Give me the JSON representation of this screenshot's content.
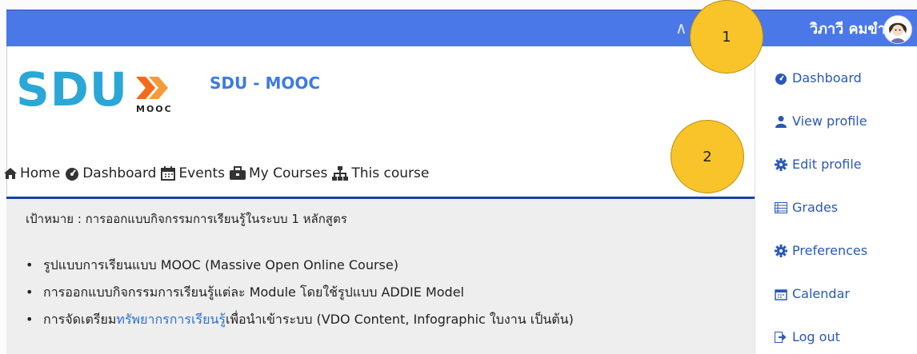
{
  "topbar": {
    "user_name": "วิภาวี คมขำ",
    "caret": "∧"
  },
  "logo": {
    "text": "SDU",
    "sub": "MOOC"
  },
  "site": {
    "name": "SDU - MOOC"
  },
  "nav": [
    {
      "label": "Home",
      "icon": "home-icon"
    },
    {
      "label": "Dashboard",
      "icon": "dashboard-icon"
    },
    {
      "label": "Events",
      "icon": "calendar-icon"
    },
    {
      "label": "My Courses",
      "icon": "briefcase-icon"
    },
    {
      "label": "This course",
      "icon": "sitemap-icon"
    }
  ],
  "content": {
    "goal": "เป้าหมาย : การออกแบบกิจกรรมการเรียนรู้ในระบบ 1 หลักสูตร",
    "bullets": [
      {
        "text": "รูปแบบการเรียนแบบ MOOC (Massive Open Online Course)"
      },
      {
        "text": "การออกแบบกิจกรรมการเรียนรู้แต่ละ Module โดยใช้รูปแบบ ADDIE Model"
      },
      {
        "pre": "การจัดเตรียม",
        "link": "ทรัพยากรการเรียนรู้",
        "post": "เพื่อนำเข้าระบบ (VDO Content, Infographic ใบงาน เป็นต้น)"
      }
    ]
  },
  "user_menu": [
    {
      "label": "Dashboard",
      "icon": "dashboard-icon"
    },
    {
      "label": "View profile",
      "icon": "user-icon"
    },
    {
      "label": "Edit profile",
      "icon": "cog-icon"
    },
    {
      "label": "Grades",
      "icon": "table-icon"
    },
    {
      "label": "Preferences",
      "icon": "cog-icon"
    },
    {
      "label": "Calendar",
      "icon": "calendar-icon"
    },
    {
      "label": "Log out",
      "icon": "sign-out-icon"
    }
  ],
  "callouts": [
    "1",
    "2"
  ],
  "colors": {
    "topbar": "#4a78e8",
    "link": "#2d72d9",
    "menu_text": "#2a58b8",
    "rule": "#1a3fa8",
    "callout": "#f8c42a"
  }
}
